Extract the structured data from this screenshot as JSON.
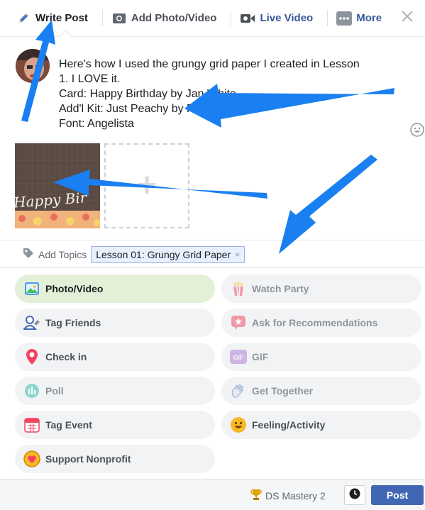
{
  "tabs": [
    {
      "label": "Write Post",
      "icon": "pencil-icon"
    },
    {
      "label": "Add Photo/Video",
      "icon": "camera-icon"
    },
    {
      "label": "Live Video",
      "icon": "video-camera-icon"
    },
    {
      "label": "More",
      "icon": "more-dots-icon"
    }
  ],
  "post": {
    "lines": [
      "Here's how I used the grungy grid paper I created in Lesson",
      "1. I LOVE it.",
      "Card: Happy Birthday by Jan White",
      "Add'l Kit: Just Peachy by Rose Nuckles",
      "Font: Angelista"
    ]
  },
  "attachment": {
    "thumb_text": "Happy Bir"
  },
  "topics": {
    "label": "Add Topics",
    "chip": "Lesson 01: Grungy Grid Paper",
    "chip_remove": "×"
  },
  "options": [
    {
      "label": "Photo/Video",
      "icon": "photo-icon"
    },
    {
      "label": "Watch Party",
      "icon": "popcorn-icon"
    },
    {
      "label": "Tag Friends",
      "icon": "tag-friends-icon"
    },
    {
      "label": "Ask for Recommendations",
      "icon": "recommendation-icon"
    },
    {
      "label": "Check in",
      "icon": "location-pin-icon"
    },
    {
      "label": "GIF",
      "icon": "gif-icon"
    },
    {
      "label": "Poll",
      "icon": "poll-icon"
    },
    {
      "label": "Get Together",
      "icon": "hand-wave-icon"
    },
    {
      "label": "Tag Event",
      "icon": "calendar-icon"
    },
    {
      "label": "Feeling/Activity",
      "icon": "smiley-icon"
    },
    {
      "label": "Support Nonprofit",
      "icon": "heart-coin-icon"
    }
  ],
  "footer": {
    "audience": "DS Mastery 2",
    "post_label": "Post"
  },
  "colors": {
    "accent": "#4267b2",
    "selected_option": "#e3efd6",
    "annotation_arrow": "#1a7ff0"
  }
}
